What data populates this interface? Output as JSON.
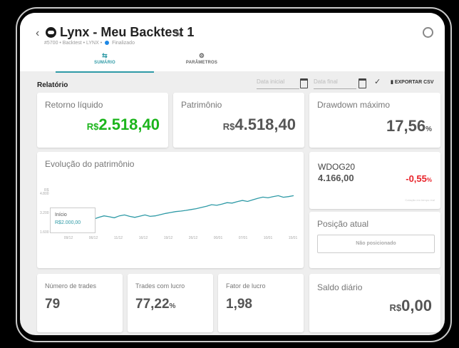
{
  "header": {
    "title": "Lynx - Meu Backtest 1",
    "meta_prefix": "#5700 • Backtest • LYNX •",
    "status": "Finalizado"
  },
  "tabs": [
    {
      "label": "SUMÁRIO",
      "icon": "swap-icon",
      "active": true
    },
    {
      "label": "PARÂMETROS",
      "icon": "settings-icon",
      "active": false
    }
  ],
  "report": {
    "title": "Relatório",
    "start_placeholder": "Data inicial",
    "end_placeholder": "Data final",
    "export_label": "EXPORTAR CSV"
  },
  "cards": {
    "net_return": {
      "label": "Retorno líquido",
      "currency": "R$",
      "value": "2.518,40",
      "color": "#1cb51c"
    },
    "equity": {
      "label": "Patrimônio",
      "currency": "R$",
      "value": "4.518,40"
    },
    "max_drawdown": {
      "label": "Drawdown máximo",
      "value": "17,56",
      "unit": "%"
    },
    "asset": {
      "symbol": "WDOG20",
      "price": "4.166,00",
      "change": "-0,55",
      "unit": "%",
      "note": "Cotação em tempo real",
      "color": "#e8232a"
    },
    "position": {
      "label": "Posição atual",
      "button": "Não posicionado"
    },
    "num_trades": {
      "label": "Número de trades",
      "value": "79"
    },
    "winning_trades": {
      "label": "Trades com lucro",
      "value": "77,22",
      "unit": "%"
    },
    "profit_factor": {
      "label": "Fator de lucro",
      "value": "1,98"
    },
    "daily_balance": {
      "label": "Saldo diário",
      "currency": "R$",
      "value": "0,00"
    }
  },
  "chart_data": {
    "type": "line",
    "title": "Evolução do patrimônio",
    "ylabel": "R$",
    "yticks": [
      "4.800",
      "3.200",
      "1.600"
    ],
    "ylim": [
      1600,
      4800
    ],
    "xticks": [
      "09/12",
      "06/12",
      "11/12",
      "16/12",
      "19/12",
      "26/12",
      "00/01",
      "07/01",
      "10/01",
      "15/01"
    ],
    "series": [
      {
        "values": [
          2000,
          2120,
          2300,
          2380,
          2470,
          2560,
          2600,
          2520,
          2650,
          2800,
          2920,
          2850,
          2760,
          2920,
          3000,
          2880,
          2800,
          2900,
          3000,
          2880,
          2920,
          3020,
          3120,
          3200,
          3280,
          3320,
          3380,
          3450,
          3520,
          3620,
          3720,
          3850,
          3800,
          3900,
          4020,
          3980,
          4100,
          4200,
          4120,
          4250,
          4380,
          4480,
          4420,
          4520,
          4600,
          4470,
          4520,
          4600
        ]
      }
    ],
    "tooltip": {
      "label": "Início",
      "value": "R$2.000,00"
    },
    "grid": false,
    "line_color": "#2e9aa6"
  }
}
